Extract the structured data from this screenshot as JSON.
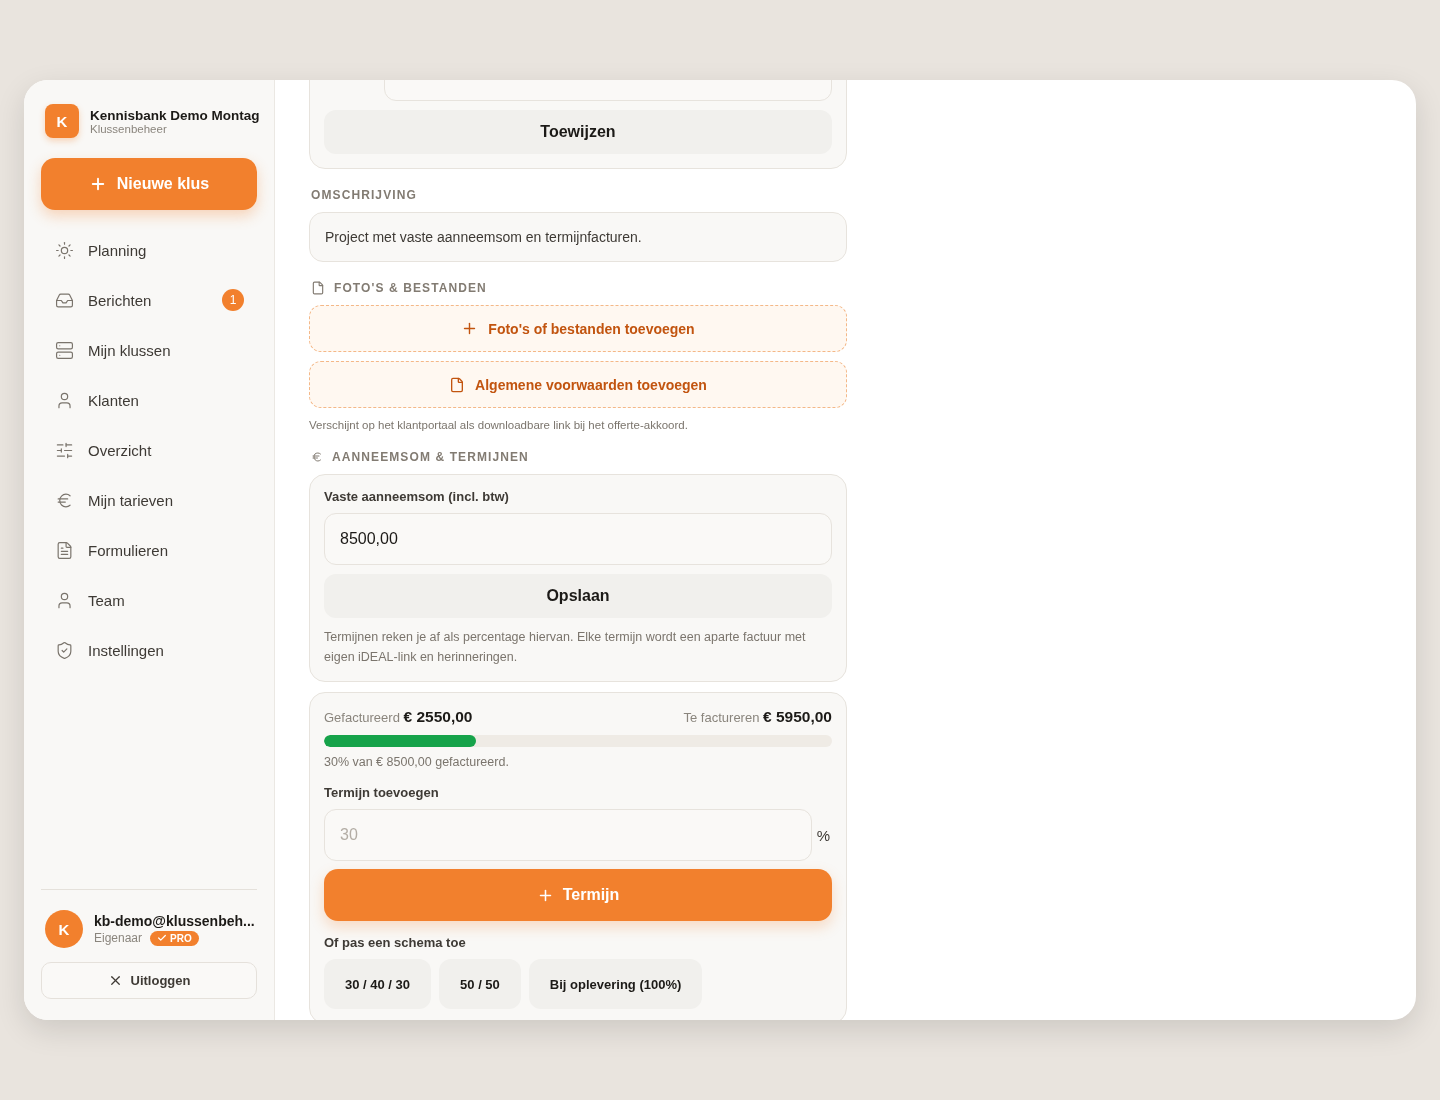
{
  "sidebar": {
    "org": {
      "initial": "K",
      "name": "Kennisbank Demo Montag",
      "subtitle": "Klussenbeheer"
    },
    "new_button": "Nieuwe klus",
    "items": [
      {
        "label": "Planning"
      },
      {
        "label": "Berichten",
        "badge": "1"
      },
      {
        "label": "Mijn klussen"
      },
      {
        "label": "Klanten"
      },
      {
        "label": "Overzicht"
      },
      {
        "label": "Mijn tarieven"
      },
      {
        "label": "Formulieren"
      },
      {
        "label": "Team"
      },
      {
        "label": "Instellingen"
      }
    ],
    "user": {
      "initial": "K",
      "email": "kb-demo@klussenbeh...",
      "role": "Eigenaar",
      "badge": "PRO"
    },
    "logout": "Uitloggen"
  },
  "main": {
    "assign_button": "Toewijzen",
    "description": {
      "heading": "OMSCHRIJVING",
      "text": "Project met vaste aanneemsom en termijnfacturen."
    },
    "files": {
      "heading": "FOTO'S & BESTANDEN",
      "buttons": [
        "Foto's of bestanden toevoegen",
        "Algemene voorwaarden toevoegen"
      ],
      "note": "Verschijnt op het klantportaal als downloadbare link bij het offerte-akkoord."
    },
    "contract": {
      "heading": "AANNEEMSOM & TERMIJNEN",
      "label": "Vaste aanneemsom (incl. btw)",
      "value": "8500,00",
      "save_button": "Opslaan",
      "help": "Termijnen reken je af als percentage hiervan. Elke termijn wordt een aparte factuur met eigen iDEAL-link en herinneringen."
    },
    "progress": {
      "invoiced_label": "Gefactureerd",
      "invoiced": "€ 2550,00",
      "remaining_label": "Te factureren",
      "remaining": "€ 5950,00",
      "level": 0.3,
      "summary": "30% van € 8500,00 gefactureerd.",
      "add_label": "Termijn toevoegen",
      "placeholder": "30",
      "unit": "%",
      "add_button": "Termijn",
      "schema_label": "Of pas een schema toe",
      "schemas": [
        "30 / 40 / 30",
        "50 / 50",
        "Bij oplevering (100%)"
      ]
    }
  }
}
